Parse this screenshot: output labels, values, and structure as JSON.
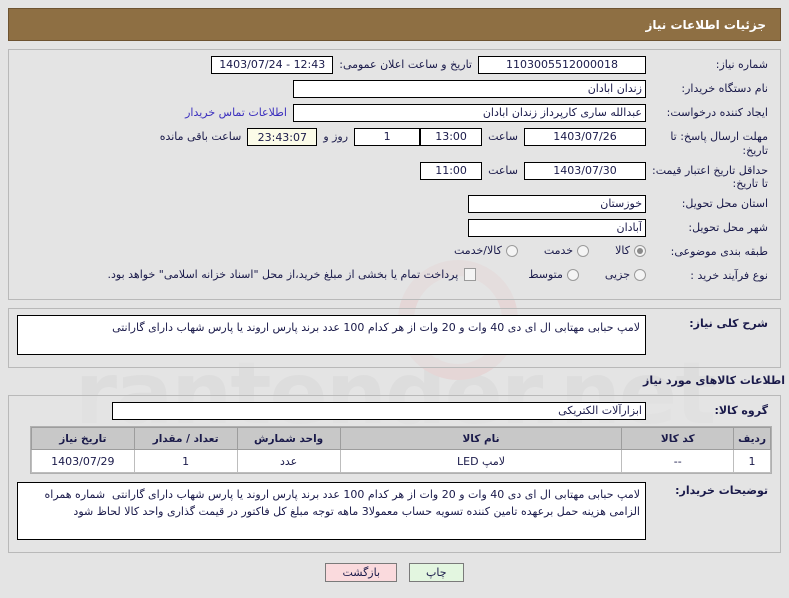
{
  "header": {
    "title": "جزئیات اطلاعات نیاز"
  },
  "form": {
    "need_number_label": "شماره نیاز:",
    "need_number_value": "1103005512000018",
    "announce_label": "تاریخ و ساعت اعلان عمومی:",
    "announce_value": "12:43 - 1403/07/24",
    "buyer_org_label": "نام دستگاه خریدار:",
    "buyer_org_value": "زندان ابادان",
    "requester_label": "ایجاد کننده درخواست:",
    "requester_value": "عبدالله ساری کارپرداز زندان ابادان",
    "contact_link": "اطلاعات تماس خریدار",
    "contact_value": "",
    "deadline_label": "مهلت ارسال پاسخ: تا تاریخ:",
    "deadline_date": "1403/07/26",
    "deadline_time_label": "ساعت",
    "deadline_time": "13:00",
    "days_value": "1",
    "days_label": "روز و",
    "timer_value": "23:43:07",
    "timer_label": "ساعت باقی مانده",
    "validity_label": "حداقل تاریخ اعتبار قیمت: تا تاریخ:",
    "validity_date": "1403/07/30",
    "validity_time_label": "ساعت",
    "validity_time": "11:00",
    "province_label": "استان محل تحویل:",
    "province_value": "خوزستان",
    "city_label": "شهر محل تحویل:",
    "city_value": "آبادان",
    "category_label": "طبقه بندی موضوعی:",
    "category_options": [
      {
        "label": "کالا",
        "selected": true
      },
      {
        "label": "خدمت",
        "selected": false
      },
      {
        "label": "کالا/خدمت",
        "selected": false
      }
    ],
    "process_label": "نوع فرآیند خرید :",
    "process_options": [
      {
        "label": "جزیی",
        "selected": false
      },
      {
        "label": "متوسط",
        "selected": false
      }
    ],
    "payment_checkbox_label": "پرداخت تمام یا بخشی از مبلغ خرید،از محل \"اسناد خزانه اسلامی\" خواهد بود.",
    "payment_checked": false
  },
  "need_description": {
    "label": "شرح کلی نیاز:",
    "value": "لامپ حبابی مهتابی ال ای دی 40 وات و 20 وات از هر کدام 100 عدد برند پارس اروند یا پارس شهاب دارای گارانتی"
  },
  "goods_section": {
    "title": "اطلاعات کالاهای مورد نیاز",
    "group_label": "گروه کالا:",
    "group_value": "ابزارآلات الکتریکی",
    "table": {
      "headers": [
        "ردیف",
        "کد کالا",
        "نام کالا",
        "واحد شمارش",
        "تعداد / مقدار",
        "تاریخ نیاز"
      ],
      "rows": [
        {
          "radif": "1",
          "code": "--",
          "name": "لامپ LED",
          "unit": "عدد",
          "qty": "1",
          "date": "1403/07/29"
        }
      ]
    }
  },
  "buyer_notes": {
    "label": "توضیحات خریدار:",
    "value": "لامپ حبابی مهتابی ال ای دی 40 وات و 20 وات از هر کدام 100 عدد برند پارس اروند یا پارس شهاب دارای گارانتی  شماره همراه الزامی هزینه حمل برعهده تامین کننده تسویه حساب معمولا3 ماهه توجه مبلغ کل فاکتور در قیمت گذاری واحد کالا لحاظ شود"
  },
  "buttons": {
    "print": "چاپ",
    "back": "بازگشت"
  },
  "watermark": {
    "text": "rantender.net"
  },
  "colors": {
    "header_bg": "#8e6f43",
    "page_bg": "#e4e4e4",
    "text": "#1a1a4a",
    "link": "#3b2fbe",
    "timer_bg": "#fbfbe8",
    "print_btn": "#e3f6e0",
    "back_btn": "#fadadd"
  }
}
